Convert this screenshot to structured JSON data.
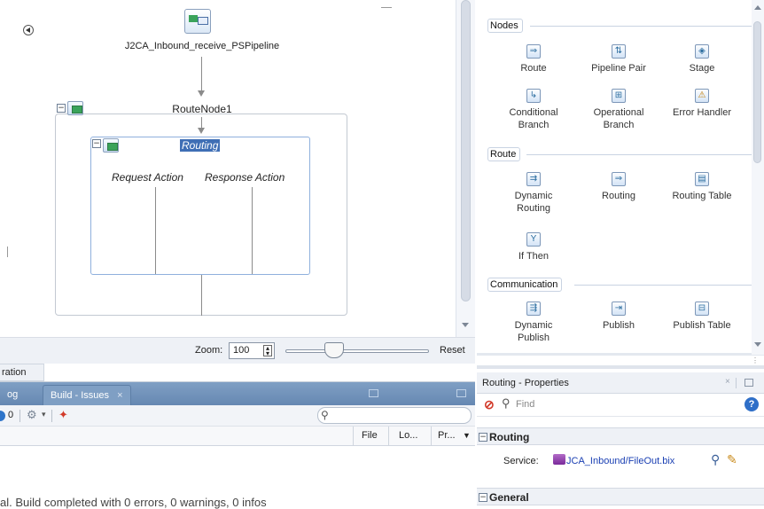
{
  "canvas": {
    "service_label": "J2CA_Inbound_receive_PSPipeline",
    "route_node_label": "RouteNode1",
    "routing_label": "Routing",
    "request_action_label": "Request Action",
    "response_action_label": "Response Action"
  },
  "zoom": {
    "label": "Zoom:",
    "value": "100",
    "reset_label": "Reset"
  },
  "bottom": {
    "partial_tab_label": "ration",
    "log_tab_label": "og",
    "build_tab_label": "Build - Issues",
    "close_glyph": "×",
    "error_count": "0",
    "columns": [
      "File",
      "Lo...",
      "Pr..."
    ],
    "status_text": "al. Build completed with 0 errors, 0 warnings, 0 infos"
  },
  "palette": {
    "categories": [
      {
        "label": "Nodes",
        "items": [
          {
            "label": "Route",
            "icon": "route-icon"
          },
          {
            "label": "Pipeline Pair",
            "icon": "pipeline-pair-icon"
          },
          {
            "label": "Stage",
            "icon": "stage-icon"
          },
          {
            "label": "Conditional Branch",
            "icon": "conditional-branch-icon"
          },
          {
            "label": "Operational Branch",
            "icon": "operational-branch-icon"
          },
          {
            "label": "Error Handler",
            "icon": "error-handler-icon"
          }
        ]
      },
      {
        "label": "Route",
        "items": [
          {
            "label": "Dynamic Routing",
            "icon": "dynamic-routing-icon"
          },
          {
            "label": "Routing",
            "icon": "routing-icon"
          },
          {
            "label": "Routing Table",
            "icon": "routing-table-icon"
          },
          {
            "label": "If Then",
            "icon": "if-then-icon"
          }
        ]
      },
      {
        "label": "Communication",
        "items": [
          {
            "label": "Dynamic Publish",
            "icon": "dynamic-publish-icon"
          },
          {
            "label": "Publish",
            "icon": "publish-icon"
          },
          {
            "label": "Publish Table",
            "icon": "publish-table-icon"
          }
        ]
      }
    ]
  },
  "properties": {
    "title": "Routing - Properties",
    "find_placeholder": "Find",
    "routing_section": "Routing",
    "service_label": "Service:",
    "service_value": "JCA_Inbound/FileOut.bix",
    "general_section": "General"
  },
  "colors": {
    "tab_blue": "#6f91bb",
    "selection_blue": "#3f6fb5",
    "box_border": "#8fb0dd"
  }
}
